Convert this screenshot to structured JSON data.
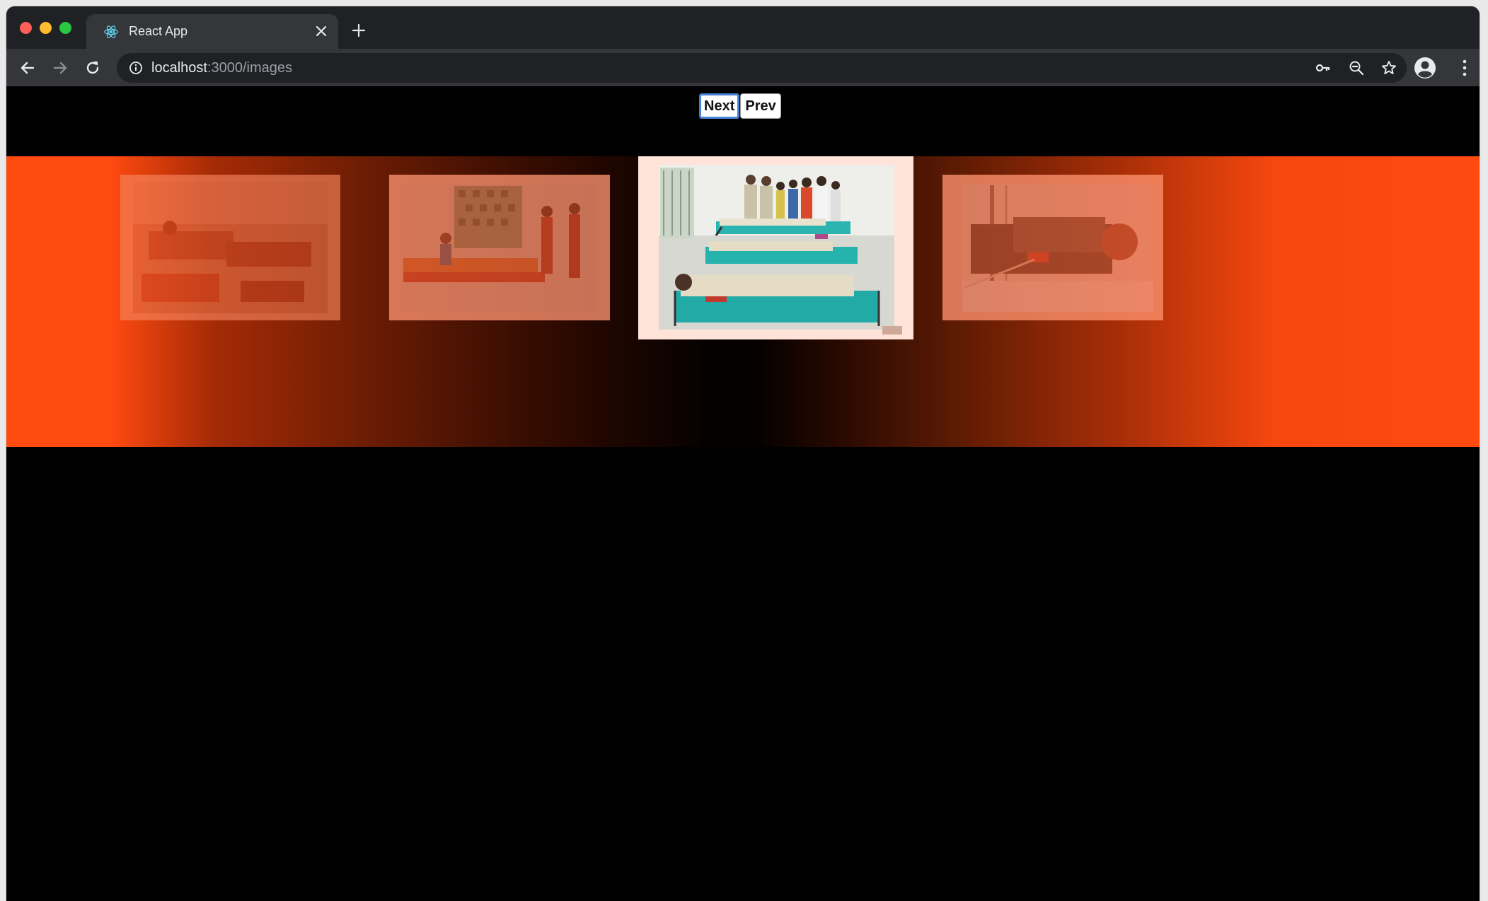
{
  "browser": {
    "tab_title": "React App",
    "url_host": "localhost",
    "url_path": ":3000/images"
  },
  "icons": {
    "favicon": "react-logo-icon",
    "tab_close": "close-icon",
    "new_tab": "plus-icon",
    "back": "arrow-left-icon",
    "forward": "arrow-right-icon",
    "reload": "reload-icon",
    "site_info": "info-icon",
    "passwords": "key-icon",
    "zoom": "zoom-out-icon",
    "bookmark": "star-icon",
    "profile": "profile-avatar-icon",
    "menu": "more-vertical-icon"
  },
  "controls": {
    "next_label": "Next",
    "prev_label": "Prev"
  },
  "carousel": {
    "images": [
      "blood donation hall, donors on recliner beds",
      "blood donation camp, donor lying on bed with nurses standing",
      "police officers donating blood lying on teal beds, officials standing",
      "officer in uniform lying donating blood"
    ],
    "active_index": 2
  },
  "colors": {
    "band": "#ff4a10",
    "frame": "#ffe3d8",
    "page_bg": "#000000",
    "chrome_dark": "#202124",
    "chrome_mid": "#35363a"
  }
}
